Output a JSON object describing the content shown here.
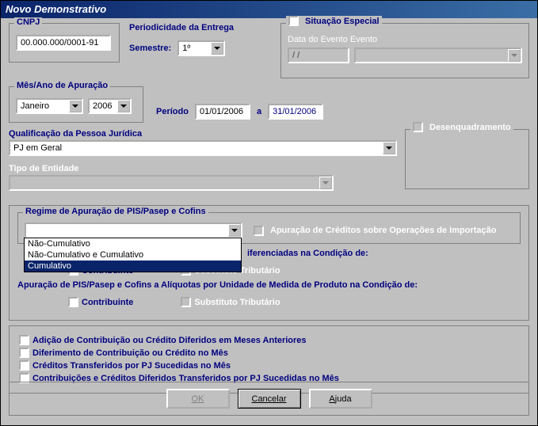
{
  "title": "Novo Demonstrativo",
  "cnpj": {
    "label": "CNPJ",
    "value": "00.000.000/0001-91"
  },
  "periodicidade": {
    "label": "Periodicidade da Entrega",
    "semestre_label": "Semestre:",
    "semestre_value": "1º"
  },
  "situacao": {
    "label": "Situação Especial",
    "data_label": "Data do Evento Evento",
    "data_value": "  /  /",
    "evento_value": ""
  },
  "mes_ano": {
    "label": "Mês/Ano de Apuração",
    "mes": "Janeiro",
    "ano": "2006"
  },
  "periodo": {
    "label": "Período",
    "de": "01/01/2006",
    "a_label": "a",
    "ate": "31/01/2006"
  },
  "qualificacao": {
    "label": "Qualificação da Pessoa Jurídica",
    "value": "PJ em Geral"
  },
  "desenquadramento": {
    "label": "Desenquadramento"
  },
  "tipo_entidade": {
    "label": "Tipo de Entidade",
    "value": ""
  },
  "regime": {
    "label": "Regime de Apuração de PIS/Pasep e Cofins",
    "value": "",
    "options": [
      "Não-Cumulativo",
      "Não-Cumulativo e Cumulativo",
      "Cumulativo"
    ],
    "cb_importacao": "Apuração de Créditos sobre Operações de Importação"
  },
  "aliq_dif": {
    "label_partial": "iferenciadas na Condição de:",
    "contribuinte": "Contribuinte",
    "substituto": "Substituto Tributário"
  },
  "aliq_unid": {
    "label": "Apuração de PIS/Pasep e Cofins a Alíquotas por Unidade de Medida de Produto na Condição de:",
    "contribuinte": "Contribuinte",
    "substituto": "Substituto Tributário"
  },
  "bottom": {
    "cb1": "Adição de Contribuição ou Crédito Diferidos em Meses Anteriores",
    "cb2": "Diferimento de Contribuição ou Crédito no Mês",
    "cb3": "Créditos Transferidos por PJ Sucedidas no Mês",
    "cb4": "Contribuições e Créditos Diferidos Transferidos por PJ Sucedidas no Mês"
  },
  "buttons": {
    "ok": "OK",
    "cancelar": "Cancelar",
    "ajuda": "Ajuda"
  }
}
